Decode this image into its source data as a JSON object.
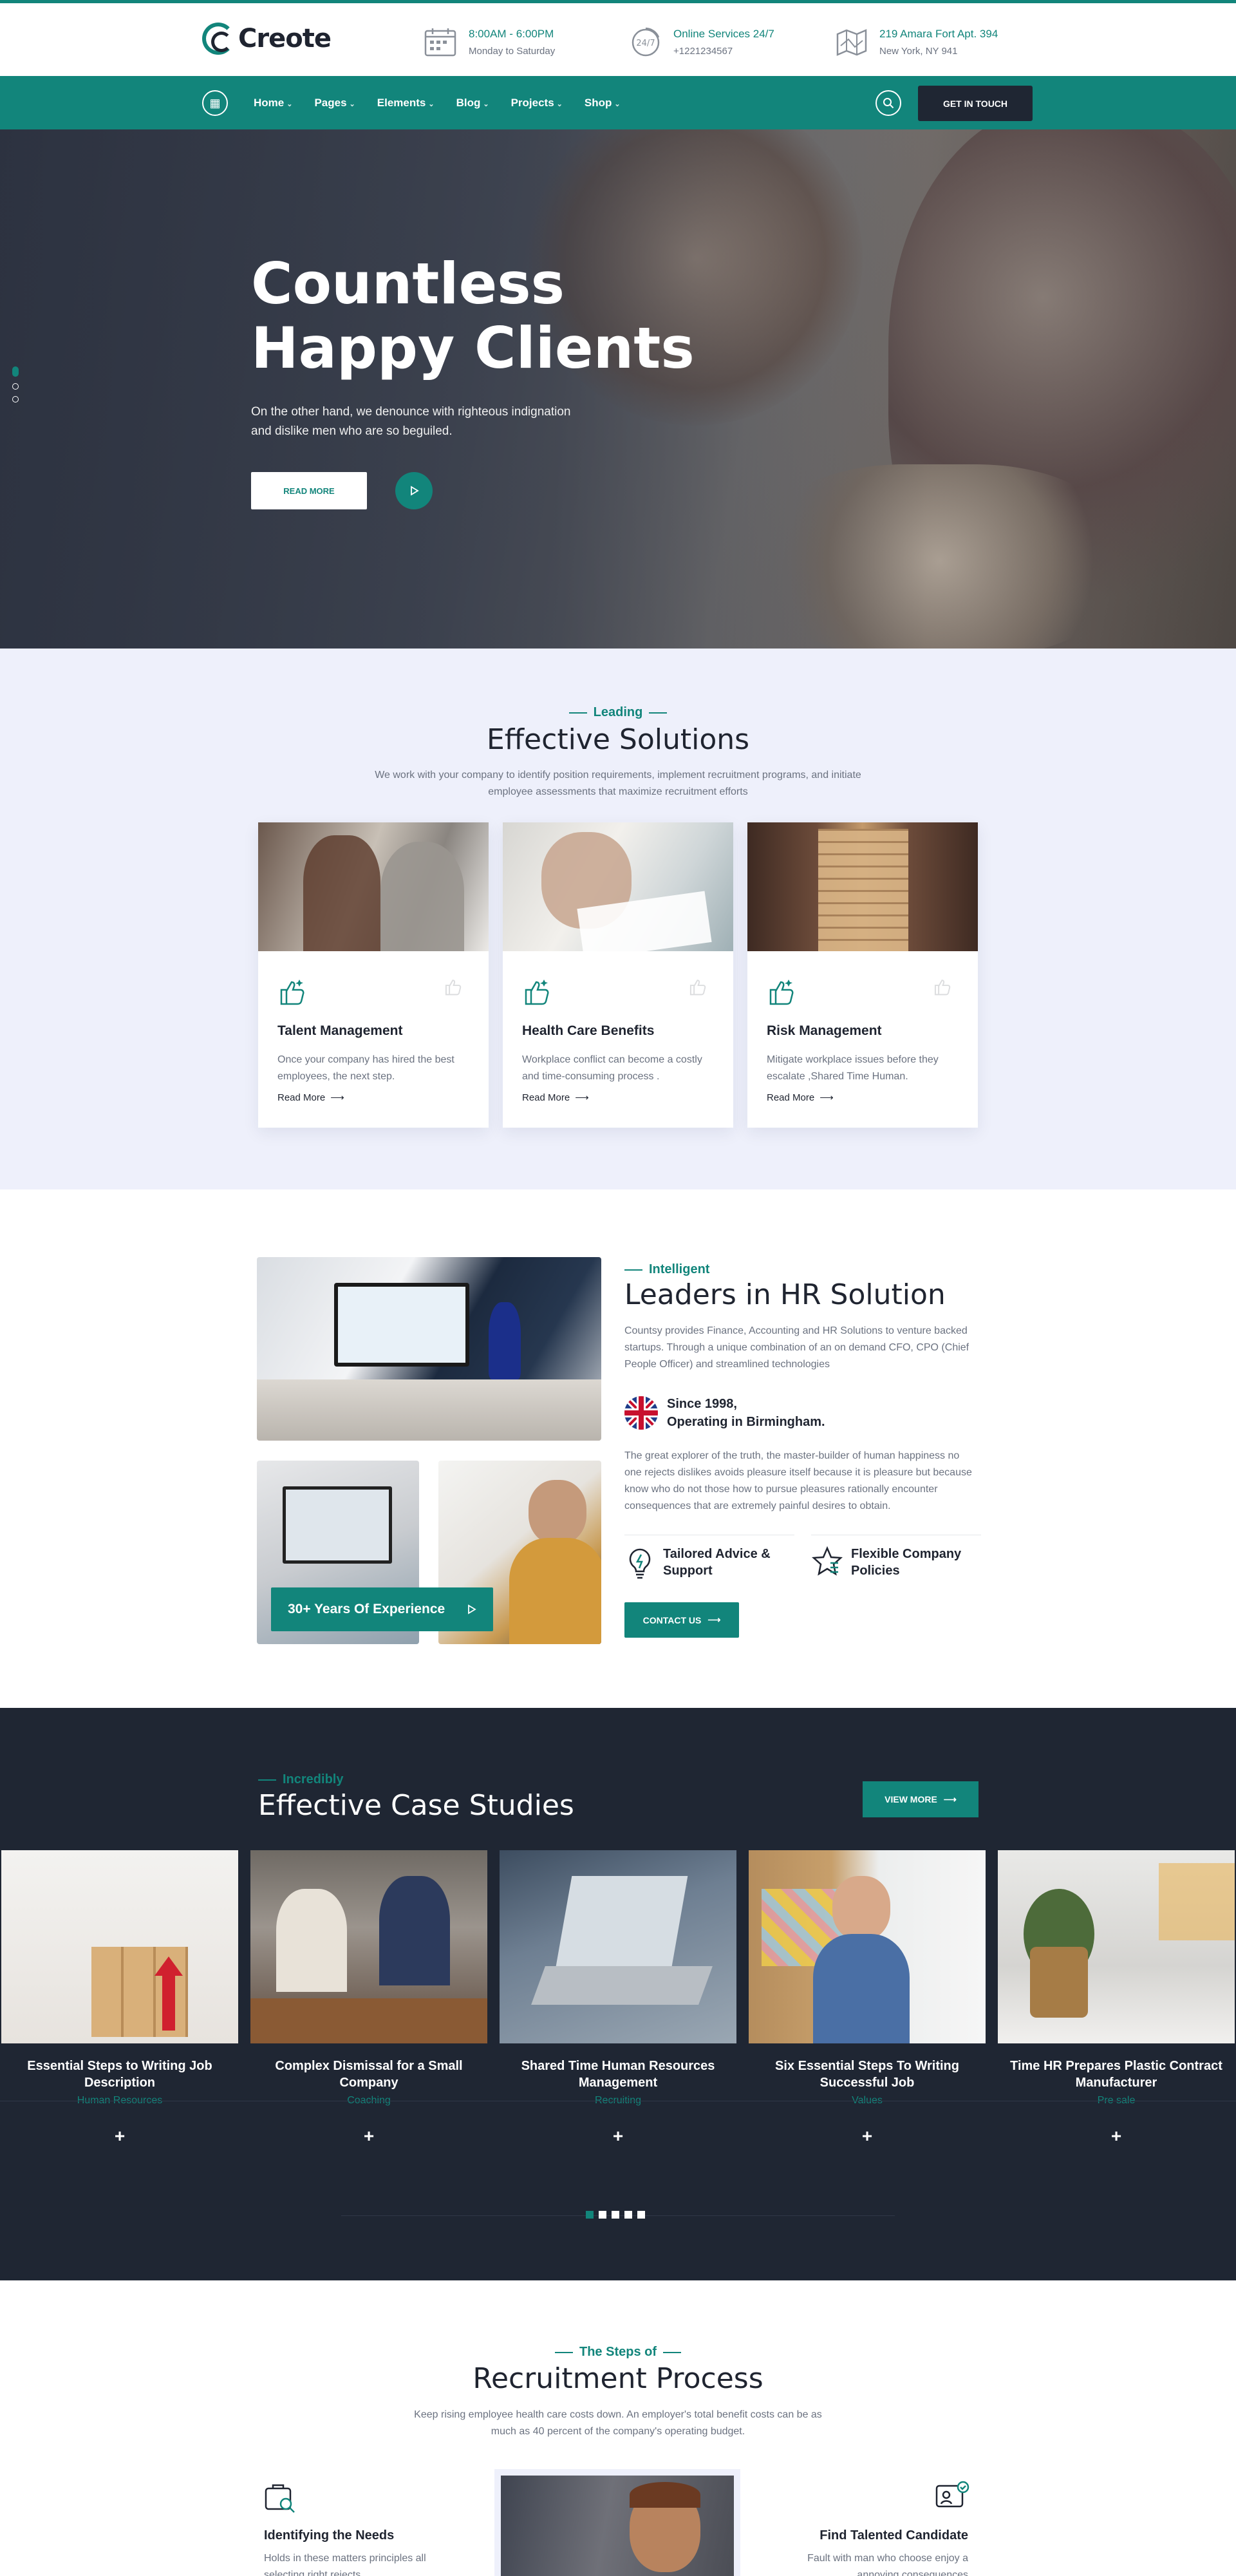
{
  "brand": {
    "name": "Creote",
    "accent": "#12857b",
    "dark": "#1f2633"
  },
  "topbar": {
    "hours": {
      "title": "8:00AM - 6:00PM",
      "sub": "Monday to Saturday",
      "icon": "calendar-icon"
    },
    "online": {
      "title": "Online Services 24/7",
      "sub": "+1221234567",
      "icon": "support-24-7-icon"
    },
    "address": {
      "title": "219 Amara Fort Apt. 394",
      "sub": "New York, NY 941",
      "icon": "map-icon"
    }
  },
  "nav": {
    "items": [
      {
        "label": "Home"
      },
      {
        "label": "Pages"
      },
      {
        "label": "Elements"
      },
      {
        "label": "Blog"
      },
      {
        "label": "Projects"
      },
      {
        "label": "Shop"
      }
    ],
    "cta": "GET IN TOUCH"
  },
  "hero": {
    "title_line1": "Countless",
    "title_line2": "Happy Clients",
    "sub": "On the other hand, we denounce with righteous indignation and dislike men who are so beguiled.",
    "button": "READ MORE"
  },
  "solutions": {
    "eyebrow": "Leading",
    "title": "Effective Solutions",
    "lead": "We work with your company to identify position requirements, implement recruitment programs, and initiate employee assessments that maximize recruitment efforts",
    "cards": [
      {
        "title": "Talent Management",
        "text": "Once your company has hired the best employees, the next step.",
        "more": "Read More"
      },
      {
        "title": "Health Care Benefits",
        "text": "Workplace conflict can become a costly and time-consuming process .",
        "more": "Read More"
      },
      {
        "title": "Risk Management",
        "text": "Mitigate workplace issues before they escalate ,Shared Time Human.",
        "more": "Read More"
      }
    ]
  },
  "hr": {
    "eyebrow": "Intelligent",
    "title": "Leaders in HR Solution",
    "lead": "Countsy provides Finance, Accounting and HR Solutions to venture backed startups. Through a unique combination of an on demand CFO, CPO (Chief People Officer) and streamlined technologies",
    "since_l1": "Since 1998,",
    "since_l2": "Operating in Birmingham.",
    "body": "The great explorer of the truth, the master-builder of human happiness no one rejects dislikes avoids pleasure itself because it is pleasure but because know who do not those how to pursue pleasures rationally encounter consequences that are extremely painful desires to obtain.",
    "feat1": "Tailored Advice & Support",
    "feat2": "Flexible Company Policies",
    "button": "CONTACT US",
    "experience": "30+ Years Of Experience"
  },
  "cases": {
    "eyebrow": "Incredibly",
    "title": "Effective Case Studies",
    "button": "VIEW MORE",
    "items": [
      {
        "title": "Essential Steps to Writing Job Description",
        "category": "Human Resources"
      },
      {
        "title": "Complex Dismissal for a Small Company",
        "category": "Coaching"
      },
      {
        "title": "Shared Time Human Resources Management",
        "category": "Recruiting"
      },
      {
        "title": "Six Essential Steps To Writing Successful Job",
        "category": "Values"
      },
      {
        "title": "Time HR Prepares Plastic Contract Manufacturer",
        "category": "Pre sale"
      }
    ]
  },
  "recruitment": {
    "eyebrow": "The Steps of",
    "title": "Recruitment Process",
    "lead": "Keep rising employee health care costs down. An employer's total benefit costs can be as much as 40 percent of the company's operating budget.",
    "step1_title": "Identifying the Needs",
    "step1_text": "Holds in these matters principles all selecting right rejects",
    "step2_title": "Find Talented Candidate",
    "step2_text": "Fault with man who choose enjoy a annoying consequences"
  }
}
